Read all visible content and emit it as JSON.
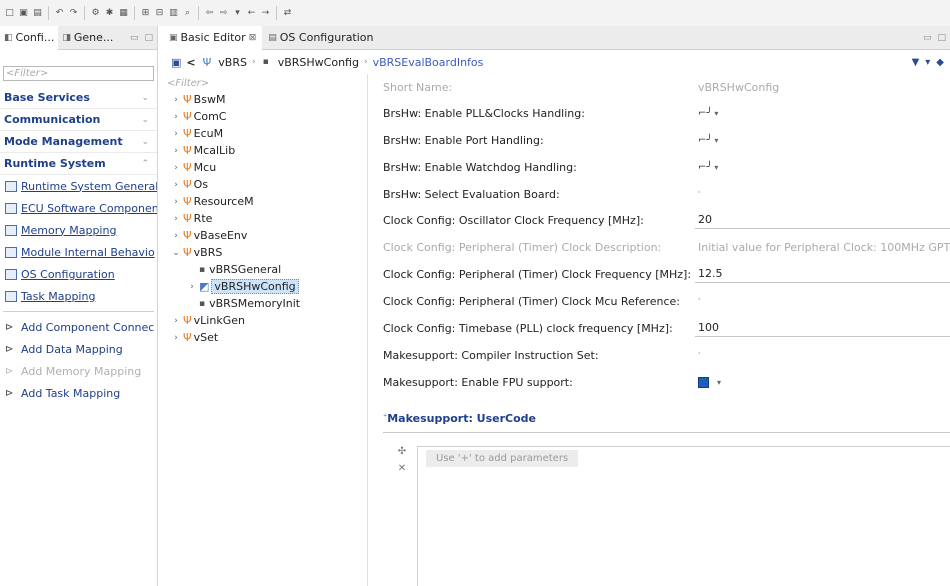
{
  "toolbar": {
    "icons": [
      "new-file-icon",
      "open-icon",
      "save-icon",
      "undo-icon",
      "redo-icon",
      "generate-icon",
      "settings-icon",
      "validate-icon",
      "layout-icon",
      "tree-icon",
      "table-icon",
      "search-icon",
      "back-icon",
      "forward-icon",
      "dropdown-icon",
      "nav-back-icon",
      "nav-forward-icon",
      "sync-icon"
    ]
  },
  "left_panel": {
    "tabs": [
      {
        "label": "Confi..."
      },
      {
        "label": "Gene..."
      }
    ],
    "filter_placeholder": "<Filter>",
    "categories": [
      {
        "label": "Base Services"
      },
      {
        "label": "Communication"
      },
      {
        "label": "Mode Management"
      },
      {
        "label": "Runtime System"
      }
    ],
    "nav_items": [
      {
        "label": "Runtime System General"
      },
      {
        "label": "ECU Software Componen"
      },
      {
        "label": "Memory Mapping"
      },
      {
        "label": "Module Internal Behavio"
      },
      {
        "label": "OS Configuration"
      },
      {
        "label": "Task Mapping"
      }
    ],
    "actions": [
      {
        "label": "Add Component Connec",
        "disabled": false
      },
      {
        "label": "Add Data Mapping",
        "disabled": false
      },
      {
        "label": "Add Memory Mapping",
        "disabled": true
      },
      {
        "label": "Add Task Mapping",
        "disabled": false
      }
    ]
  },
  "editor_tabs": [
    {
      "label": "Basic Editor"
    },
    {
      "label": "OS Configuration"
    }
  ],
  "breadcrumb": {
    "items": [
      "vBRS",
      "vBRSHwConfig",
      "vBRSEvalBoardInfos"
    ]
  },
  "tree": {
    "filter_placeholder": "<Filter>",
    "nodes": [
      {
        "label": "BswM",
        "expanded": false,
        "level": 0
      },
      {
        "label": "ComC",
        "expanded": false,
        "level": 0
      },
      {
        "label": "EcuM",
        "expanded": false,
        "level": 0
      },
      {
        "label": "McalLib",
        "expanded": false,
        "level": 0
      },
      {
        "label": "Mcu",
        "expanded": false,
        "level": 0
      },
      {
        "label": "Os",
        "expanded": false,
        "level": 0
      },
      {
        "label": "ResourceM",
        "expanded": false,
        "level": 0
      },
      {
        "label": "Rte",
        "expanded": false,
        "level": 0
      },
      {
        "label": "vBaseEnv",
        "expanded": false,
        "level": 0
      },
      {
        "label": "vBRS",
        "expanded": true,
        "level": 0
      },
      {
        "label": "vBRSGeneral",
        "expanded": null,
        "level": 1
      },
      {
        "label": "vBRSHwConfig",
        "expanded": false,
        "level": 1,
        "selected": true
      },
      {
        "label": "vBRSMemoryInit",
        "expanded": null,
        "level": 1
      },
      {
        "label": "vLinkGen",
        "expanded": false,
        "level": 0
      },
      {
        "label": "vSet",
        "expanded": false,
        "level": 0
      }
    ]
  },
  "form": {
    "short_name": {
      "label": "Short Name:",
      "value": "vBRSHwConfig"
    },
    "fields": [
      {
        "label": "BrsHw: Enable PLL&Clocks Handling:",
        "value": "",
        "kind": "check"
      },
      {
        "label": "BrsHw: Enable Port Handling:",
        "value": "",
        "kind": "check"
      },
      {
        "label": "BrsHw: Enable Watchdog Handling:",
        "value": "",
        "kind": "check"
      },
      {
        "label": "BrsHw: Select Evaluation Board:",
        "value": "",
        "kind": "empty"
      },
      {
        "label": "Clock Config: Oscillator Clock Frequency [MHz]:",
        "value": "20",
        "kind": "text"
      },
      {
        "label": "Clock Config: Peripheral (Timer) Clock Description:",
        "value": "Initial value for Peripheral Clock: 100MHz GPT-",
        "kind": "dim"
      },
      {
        "label": "Clock Config: Peripheral (Timer) Clock Frequency [MHz]:",
        "value": "12.5",
        "kind": "text"
      },
      {
        "label": "Clock Config: Peripheral (Timer) Clock Mcu Reference:",
        "value": "",
        "kind": "empty"
      },
      {
        "label": "Clock Config: Timebase (PLL) clock frequency [MHz]:",
        "value": "100",
        "kind": "text"
      },
      {
        "label": "Makesupport: Compiler Instruction Set:",
        "value": "",
        "kind": "empty"
      },
      {
        "label": "Makesupport: Enable FPU support:",
        "value": "",
        "kind": "bluecheck"
      }
    ],
    "usercode_title": "Makesupport: UserCode",
    "usercode_hint": "Use '+' to add parameters"
  }
}
